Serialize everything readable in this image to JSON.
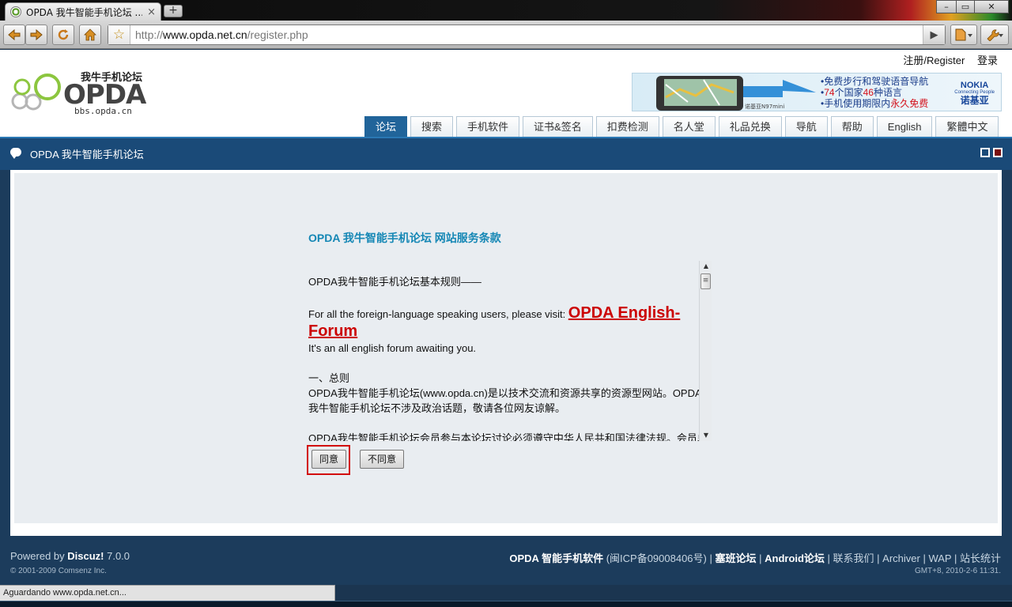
{
  "browser": {
    "tab_title": "OPDA 我牛智能手机论坛 ...",
    "tab_close": "×",
    "new_tab": "+",
    "window_controls": {
      "minimize": "–",
      "maximize": "▭",
      "close": "✕"
    },
    "url_scheme": "http://",
    "url_host": "www.opda.net.cn",
    "url_path": "/register.php",
    "icons": [
      "back-icon",
      "forward-icon",
      "reload-icon",
      "home-icon",
      "bookmark-star-icon",
      "go-icon",
      "page-menu-icon",
      "wrench-icon"
    ]
  },
  "site": {
    "toplinks": {
      "register": "注册/Register",
      "login": "登录"
    },
    "logo": {
      "cn": "我牛手机论坛",
      "brand": "OPDA",
      "domain": "bbs.opda.cn"
    },
    "banner": {
      "line1": "免费步行和驾驶语音导航",
      "line2_prefix": "74",
      "line2_mid": "个国家",
      "line2_num": "46",
      "line2_suffix": "种语言",
      "line3_prefix": "手机使用期限内",
      "line3_red": "永久免费",
      "nokia": "NOKIA",
      "nokia_tagline": "Connecting People",
      "nokia_cn": "诺基亚",
      "device_label": "诺基亚N97mini"
    },
    "nav": [
      "论坛",
      "搜索",
      "手机软件",
      "证书&签名",
      "扣费检测",
      "名人堂",
      "礼品兑换",
      "导航",
      "帮助",
      "English",
      "繁體中文"
    ],
    "nav_active": 0,
    "breadcrumb": "OPDA 我牛智能手机论坛",
    "colors": {
      "accent_blue": "#1a4a78",
      "title_blue": "#1587b5",
      "highlight_red": "#d20a0a"
    }
  },
  "register": {
    "title": "OPDA 我牛智能手机论坛 网站服务条款",
    "terms": {
      "heading": "OPDA我牛智能手机论坛基本规则——",
      "foreign_prefix": "For all the foreign-language speaking users, please visit: ",
      "foreign_link": "OPDA English-Forum",
      "english_note": "It's an all english forum awaiting you.",
      "section1_title": "一、总则",
      "section1_body": "OPDA我牛智能手机论坛(www.opda.cn)是以技术交流和资源共享的资源型网站。OPDA我牛智能手机论坛不涉及政治话题，敬请各位网友谅解。",
      "section1_body2": "OPDA我牛智能手机论坛会员参与本论坛讨论必须遵守中华人民共和国法律法规。会员单独承"
    },
    "agree": "同意",
    "disagree": "不同意"
  },
  "footer": {
    "powered_prefix": "Powered by ",
    "powered_brand": "Discuz!",
    "powered_version": " 7.0.0",
    "copyright": "© 2001-2009 Comsenz Inc.",
    "link_software": "OPDA 智能手机软件",
    "icp": " (闽ICP备09008406号) ",
    "link_symbian": "塞班论坛",
    "link_android": "Android论坛",
    "link_contact": "联系我们",
    "link_archiver": "Archiver",
    "link_wap": "WAP",
    "link_stats": "站长统计",
    "gmt": "GMT+8, 2010-2-6 11:31."
  },
  "status": {
    "loading": "Aguardando www.opda.net.cn..."
  }
}
